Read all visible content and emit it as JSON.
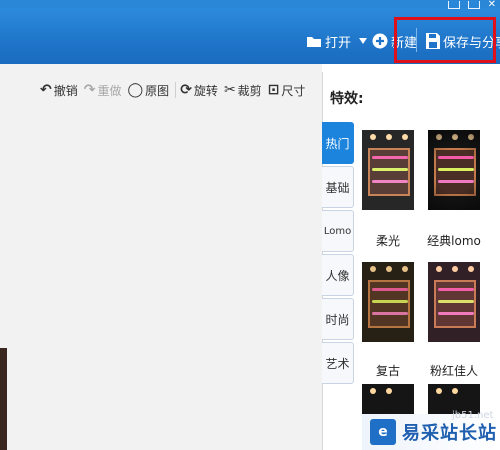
{
  "toolbar": {
    "open_label": "打开",
    "new_label": "新建",
    "save_share_label": "保存与分享"
  },
  "edit_tools": {
    "undo": "撤销",
    "redo": "重做",
    "original": "原图",
    "rotate": "旋转",
    "crop": "裁剪",
    "size": "尺寸"
  },
  "effects_panel": {
    "title": "特效:",
    "tabs": [
      "热门",
      "基础",
      "Lomo",
      "人像",
      "时尚",
      "艺术"
    ],
    "active_tab": "热门",
    "effects": [
      {
        "label": "柔光"
      },
      {
        "label": "经典lomo"
      },
      {
        "label": "复古"
      },
      {
        "label": "粉红佳人"
      }
    ]
  },
  "watermark": {
    "brand": "易采站长站",
    "url": "jb51.net"
  },
  "colors": {
    "toolbar_blue": "#1e74c8",
    "active_tab": "#1c84dd",
    "highlight_box": "#e0101a"
  }
}
